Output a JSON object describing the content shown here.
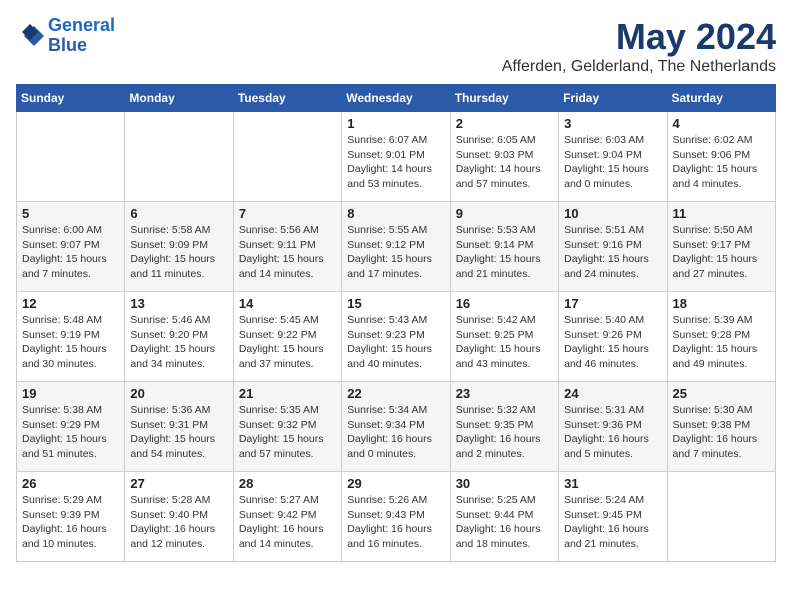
{
  "header": {
    "logo_line1": "General",
    "logo_line2": "Blue",
    "month": "May 2024",
    "location": "Afferden, Gelderland, The Netherlands"
  },
  "weekdays": [
    "Sunday",
    "Monday",
    "Tuesday",
    "Wednesday",
    "Thursday",
    "Friday",
    "Saturday"
  ],
  "weeks": [
    [
      {
        "day": "",
        "info": ""
      },
      {
        "day": "",
        "info": ""
      },
      {
        "day": "",
        "info": ""
      },
      {
        "day": "1",
        "info": "Sunrise: 6:07 AM\nSunset: 9:01 PM\nDaylight: 14 hours\nand 53 minutes."
      },
      {
        "day": "2",
        "info": "Sunrise: 6:05 AM\nSunset: 9:03 PM\nDaylight: 14 hours\nand 57 minutes."
      },
      {
        "day": "3",
        "info": "Sunrise: 6:03 AM\nSunset: 9:04 PM\nDaylight: 15 hours\nand 0 minutes."
      },
      {
        "day": "4",
        "info": "Sunrise: 6:02 AM\nSunset: 9:06 PM\nDaylight: 15 hours\nand 4 minutes."
      }
    ],
    [
      {
        "day": "5",
        "info": "Sunrise: 6:00 AM\nSunset: 9:07 PM\nDaylight: 15 hours\nand 7 minutes."
      },
      {
        "day": "6",
        "info": "Sunrise: 5:58 AM\nSunset: 9:09 PM\nDaylight: 15 hours\nand 11 minutes."
      },
      {
        "day": "7",
        "info": "Sunrise: 5:56 AM\nSunset: 9:11 PM\nDaylight: 15 hours\nand 14 minutes."
      },
      {
        "day": "8",
        "info": "Sunrise: 5:55 AM\nSunset: 9:12 PM\nDaylight: 15 hours\nand 17 minutes."
      },
      {
        "day": "9",
        "info": "Sunrise: 5:53 AM\nSunset: 9:14 PM\nDaylight: 15 hours\nand 21 minutes."
      },
      {
        "day": "10",
        "info": "Sunrise: 5:51 AM\nSunset: 9:16 PM\nDaylight: 15 hours\nand 24 minutes."
      },
      {
        "day": "11",
        "info": "Sunrise: 5:50 AM\nSunset: 9:17 PM\nDaylight: 15 hours\nand 27 minutes."
      }
    ],
    [
      {
        "day": "12",
        "info": "Sunrise: 5:48 AM\nSunset: 9:19 PM\nDaylight: 15 hours\nand 30 minutes."
      },
      {
        "day": "13",
        "info": "Sunrise: 5:46 AM\nSunset: 9:20 PM\nDaylight: 15 hours\nand 34 minutes."
      },
      {
        "day": "14",
        "info": "Sunrise: 5:45 AM\nSunset: 9:22 PM\nDaylight: 15 hours\nand 37 minutes."
      },
      {
        "day": "15",
        "info": "Sunrise: 5:43 AM\nSunset: 9:23 PM\nDaylight: 15 hours\nand 40 minutes."
      },
      {
        "day": "16",
        "info": "Sunrise: 5:42 AM\nSunset: 9:25 PM\nDaylight: 15 hours\nand 43 minutes."
      },
      {
        "day": "17",
        "info": "Sunrise: 5:40 AM\nSunset: 9:26 PM\nDaylight: 15 hours\nand 46 minutes."
      },
      {
        "day": "18",
        "info": "Sunrise: 5:39 AM\nSunset: 9:28 PM\nDaylight: 15 hours\nand 49 minutes."
      }
    ],
    [
      {
        "day": "19",
        "info": "Sunrise: 5:38 AM\nSunset: 9:29 PM\nDaylight: 15 hours\nand 51 minutes."
      },
      {
        "day": "20",
        "info": "Sunrise: 5:36 AM\nSunset: 9:31 PM\nDaylight: 15 hours\nand 54 minutes."
      },
      {
        "day": "21",
        "info": "Sunrise: 5:35 AM\nSunset: 9:32 PM\nDaylight: 15 hours\nand 57 minutes."
      },
      {
        "day": "22",
        "info": "Sunrise: 5:34 AM\nSunset: 9:34 PM\nDaylight: 16 hours\nand 0 minutes."
      },
      {
        "day": "23",
        "info": "Sunrise: 5:32 AM\nSunset: 9:35 PM\nDaylight: 16 hours\nand 2 minutes."
      },
      {
        "day": "24",
        "info": "Sunrise: 5:31 AM\nSunset: 9:36 PM\nDaylight: 16 hours\nand 5 minutes."
      },
      {
        "day": "25",
        "info": "Sunrise: 5:30 AM\nSunset: 9:38 PM\nDaylight: 16 hours\nand 7 minutes."
      }
    ],
    [
      {
        "day": "26",
        "info": "Sunrise: 5:29 AM\nSunset: 9:39 PM\nDaylight: 16 hours\nand 10 minutes."
      },
      {
        "day": "27",
        "info": "Sunrise: 5:28 AM\nSunset: 9:40 PM\nDaylight: 16 hours\nand 12 minutes."
      },
      {
        "day": "28",
        "info": "Sunrise: 5:27 AM\nSunset: 9:42 PM\nDaylight: 16 hours\nand 14 minutes."
      },
      {
        "day": "29",
        "info": "Sunrise: 5:26 AM\nSunset: 9:43 PM\nDaylight: 16 hours\nand 16 minutes."
      },
      {
        "day": "30",
        "info": "Sunrise: 5:25 AM\nSunset: 9:44 PM\nDaylight: 16 hours\nand 18 minutes."
      },
      {
        "day": "31",
        "info": "Sunrise: 5:24 AM\nSunset: 9:45 PM\nDaylight: 16 hours\nand 21 minutes."
      },
      {
        "day": "",
        "info": ""
      }
    ]
  ]
}
